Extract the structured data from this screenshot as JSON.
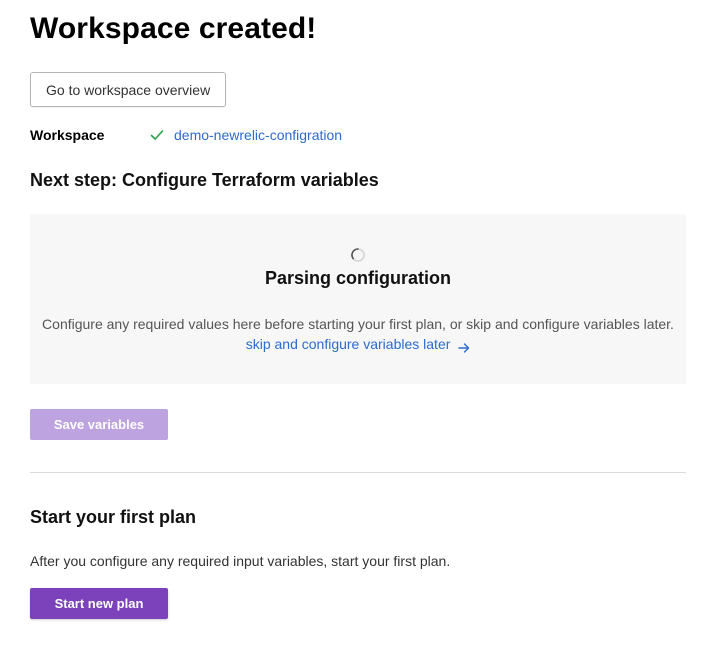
{
  "page": {
    "title": "Workspace created!"
  },
  "actions": {
    "overview_label": "Go to workspace overview"
  },
  "workspace": {
    "label": "Workspace",
    "status_icon": "check-icon",
    "name": "demo-newrelic-configration"
  },
  "variables": {
    "heading": "Next step: Configure Terraform variables",
    "spinner_icon": "loading-spinner-icon",
    "parsing_title": "Parsing configuration",
    "description": "Configure any required values here before starting your first plan, or skip and configure variables later.",
    "skip_label": "skip and configure variables later",
    "skip_icon": "arrow-right-icon",
    "save_label": "Save variables"
  },
  "plan": {
    "heading": "Start your first plan",
    "description": "After you configure any required input variables, start your first plan.",
    "start_label": "Start new plan"
  },
  "colors": {
    "link": "#2d6bd0",
    "success": "#2e9e49",
    "primary": "#7b42bc",
    "primary_disabled": "#bda3e0",
    "panel_bg": "#f7f7f7"
  }
}
